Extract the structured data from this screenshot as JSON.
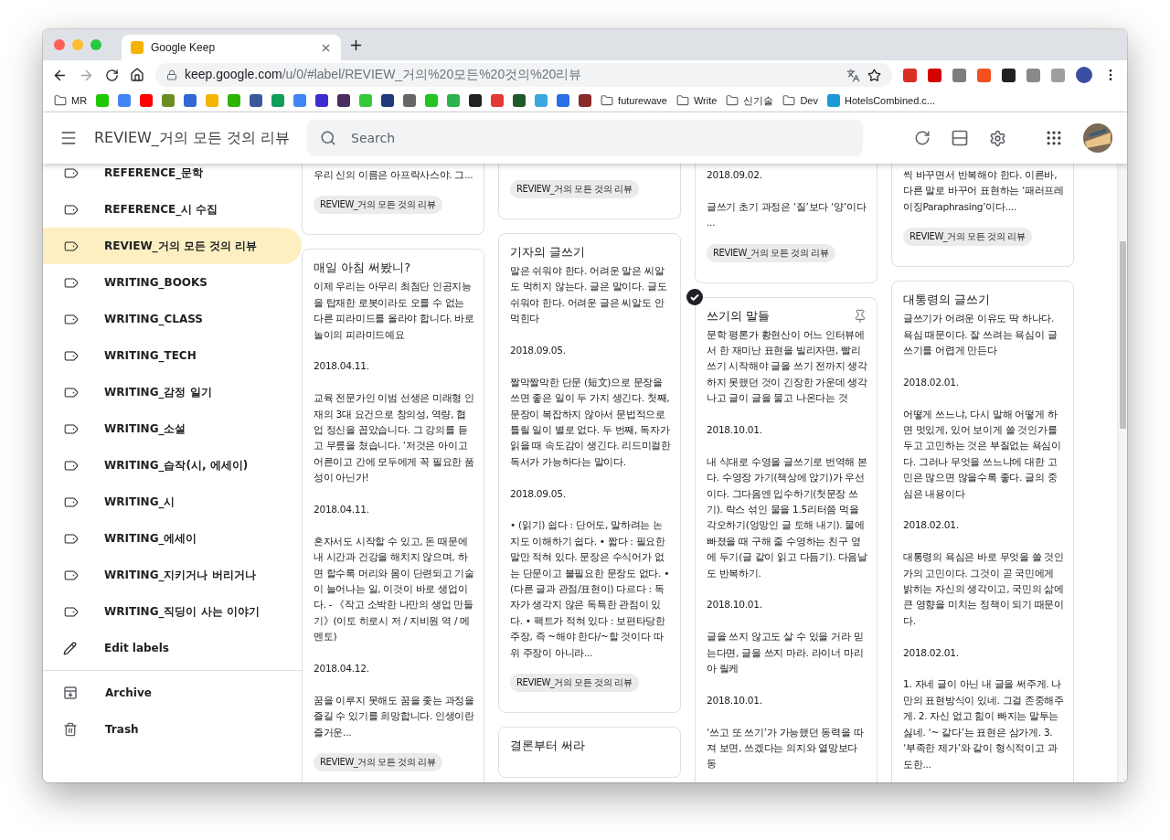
{
  "browser": {
    "tab": {
      "title": "Google Keep"
    },
    "url": {
      "host": "keep.google.com",
      "path": "/u/0/#label/REVIEW_거의%20모든%20것의%20리뷰"
    },
    "bookmarks": [
      {
        "kind": "folder",
        "label": "MR"
      },
      {
        "kind": "site",
        "color": "#1ec800"
      },
      {
        "kind": "site",
        "color": "#4285f4"
      },
      {
        "kind": "site",
        "color": "#ff0000"
      },
      {
        "kind": "site",
        "color": "#6b8e23"
      },
      {
        "kind": "site",
        "color": "#3367d6"
      },
      {
        "kind": "site",
        "color": "#f4b400"
      },
      {
        "kind": "site",
        "color": "#2db400"
      },
      {
        "kind": "site",
        "color": "#3b5998"
      },
      {
        "kind": "site",
        "color": "#0f9d58"
      },
      {
        "kind": "site",
        "color": "#4285f4"
      },
      {
        "kind": "site",
        "color": "#3f2bd0"
      },
      {
        "kind": "site",
        "color": "#4a2c5e"
      },
      {
        "kind": "site",
        "color": "#37c837"
      },
      {
        "kind": "site",
        "color": "#1f3a7a"
      },
      {
        "kind": "site",
        "color": "#666666"
      },
      {
        "kind": "site",
        "color": "#22c522"
      },
      {
        "kind": "site",
        "color": "#2bb24c"
      },
      {
        "kind": "site",
        "color": "#222222"
      },
      {
        "kind": "site",
        "color": "#e53935"
      },
      {
        "kind": "site",
        "color": "#1e5b2b"
      },
      {
        "kind": "site",
        "color": "#39a8e0"
      },
      {
        "kind": "site",
        "color": "#2a6ee8"
      },
      {
        "kind": "site",
        "color": "#8a2a2a"
      },
      {
        "kind": "folder",
        "label": "futurewave"
      },
      {
        "kind": "folder",
        "label": "Write"
      },
      {
        "kind": "folder",
        "label": "신기술"
      },
      {
        "kind": "folder",
        "label": "Dev"
      },
      {
        "kind": "site",
        "color": "#1a9bd7",
        "label": "HotelsCombined.c..."
      }
    ]
  },
  "app": {
    "title": "REVIEW_거의 모든 것의 리뷰",
    "search": {
      "placeholder": "Search"
    }
  },
  "sidebar": {
    "labels": [
      {
        "label": "REFERENCE_문학",
        "selected": false
      },
      {
        "label": "REFERENCE_시 수집",
        "selected": false
      },
      {
        "label": "REVIEW_거의 모든 것의 리뷰",
        "selected": true
      },
      {
        "label": "WRITING_BOOKS",
        "selected": false
      },
      {
        "label": "WRITING_CLASS",
        "selected": false
      },
      {
        "label": "WRITING_TECH",
        "selected": false
      },
      {
        "label": "WRITING_감정 일기",
        "selected": false
      },
      {
        "label": "WRITING_소설",
        "selected": false
      },
      {
        "label": "WRITING_습작(시, 에세이)",
        "selected": false
      },
      {
        "label": "WRITING_시",
        "selected": false
      },
      {
        "label": "WRITING_에세이",
        "selected": false
      },
      {
        "label": "WRITING_지키거나 버리거나",
        "selected": false
      },
      {
        "label": "WRITING_직딩이 사는 이야기",
        "selected": false
      }
    ],
    "edit_labels": "Edit labels",
    "bottom": [
      {
        "kind": "archive",
        "label": "Archive"
      },
      {
        "kind": "trash",
        "label": "Trash"
      }
    ]
  },
  "columns": [
    [
      {
        "cut_top": true,
        "selected": false,
        "paragraphs": [
          "우리 신의 이름은 아프락사스야. 그..."
        ],
        "chip": "REVIEW_거의 모든 것의 리뷰"
      },
      {
        "cut_top": false,
        "selected": false,
        "title": "매일 아침 써봤니?",
        "paragraphs": [
          "이제 우리는 아무리 최첨단 인공지능을 탑재한 로봇이라도 오를 수 없는 다른 피라미드를 올라야 합니다. 바로 놀이의 피라미드예요",
          "2018.04.11.",
          "교육 전문가인 이범 선생은 미래형 인재의 3대 요건으로 창의성, 역량, 협업 정신을 꼽았습니다. 그 강의를 듣고 무릎을 쳤습니다. ‘저것은 아이고 어른이고 간에 모두에게 꼭 필요한 품성이 아닌가!",
          "2018.04.11.",
          "혼자서도 시작할 수 있고, 돈 때문에 내 시간과 건강을 해치지 않으며, 하면 할수록 머리와 몸이 단련되고 기술이 늘어나는 일, 이것이 바로 생업이다. - 《작고 소박한 나만의 생업 만들기》(이토 히로시 저 / 지비원 역 / 메멘토)",
          "2018.04.12.",
          "꿈을 이루지 못해도 꿈을 좇는 과정을 즐길 수 있기를 희망합니다. 인생이란 즐거운..."
        ],
        "chip": "REVIEW_거의 모든 것의 리뷰"
      }
    ],
    [
      {
        "cut_top": true,
        "selected": false,
        "chip": "REVIEW_거의 모든 것의 리뷰"
      },
      {
        "cut_top": false,
        "selected": false,
        "title": "기자의 글쓰기",
        "paragraphs": [
          "말은 쉬워야 한다. 어려운 말은 씨알도 먹히지 않는다. 글은 말이다. 글도 쉬워야 한다. 어려운 글은 씨알도 안 먹힌다",
          "2018.09.05.",
          "짤막짤막한 단문 (短文)으로 문장을 쓰면 좋은 일이 두 가지 생긴다. 첫째, 문장이 복잡하지 않아서 문법적으로 틀릴 일이 별로 없다. 두 번째, 독자가 읽을 때 속도감이 생긴다. 리드미컬한 독서가 가능하다는 말이다.",
          "2018.09.05.",
          "• (읽기) 쉽다 : 단어도, 말하려는 논지도 이해하기 쉽다. • 짧다 : 필요한 말만 적혀 있다. 문장은 수식어가 없는 단문이고 불필요한 문장도 없다. • (다른 글과 관점/표현이) 다르다 : 독자가 생각지 않은 독특한 관점이 있다. • 팩트가 적혀 있다 : 보편타당한 주장, 즉 ~해야 한다/~할 것이다 따위 주장이 아니라..."
        ],
        "chip": "REVIEW_거의 모든 것의 리뷰"
      },
      {
        "cut_top": false,
        "selected": false,
        "title": "결론부터 써라"
      }
    ],
    [
      {
        "cut_top": true,
        "selected": false,
        "paragraphs": [
          "2018.09.02.",
          "글쓰기 초기 과정은 ‘질’보다 ‘양’이다 ..."
        ],
        "chip": "REVIEW_거의 모든 것의 리뷰"
      },
      {
        "cut_top": false,
        "selected": true,
        "title": "쓰기의 말들",
        "paragraphs": [
          "문학 평론가 황현산이 어느 인터뷰에서 한 재미난 표현을 빌리자면, 빨리 쓰기 시작해야 글을 쓰기 전까지 생각하지 못했던 것이 긴장한 가운데 생각나고 글이 글을 물고 나온다는 것",
          "2018.10.01.",
          "내 식대로 수영을 글쓰기로 번역해 본다. 수영장 가기(책상에 앉기)가 우선이다. 그다음엔 입수하기(첫문장 쓰기). 락스 섞인 물을 1.5리터쯤 먹을 각오하기(엉망인 글 토해 내기). 물에 빠졌을 때 구해 줄 수영하는 친구 옆에 두기(글 같이 읽고 다듬기). 다음날도 반복하기.",
          "2018.10.01.",
          "글을 쓰지 않고도 살 수 있을 거라 믿는다면, 글을 쓰지 마라. 라이너 마리아 릴케",
          "2018.10.01.",
          "‘쓰고 또 쓰기’가 가능했던 동력을 따져 보면, 쓰겠다는 의지와 열망보다 동"
        ]
      }
    ],
    [
      {
        "cut_top": true,
        "selected": false,
        "paragraphs": [
          "씩 바꾸면서 반복해야 한다. 이른바, 다른 말로 바꾸어 표현하는 ‘패러프레이징Paraphrasing’이다...."
        ],
        "chip": "REVIEW_거의 모든 것의 리뷰"
      },
      {
        "cut_top": false,
        "selected": false,
        "title": "대통령의 글쓰기",
        "paragraphs": [
          "글쓰기가 어려운 이유도 딱 하나다. 욕심 때문이다. 잘 쓰려는 욕심이 글쓰기를 어렵게 만든다",
          "2018.02.01.",
          "어떻게 쓰느냐, 다시 말해 어떻게 하면 멋있게, 있어 보이게 쓸 것인가를 두고 고민하는 것은 부질없는 욕심이다. 그러나 무엇을 쓰느냐에 대한 고민은 많으면 많을수록 좋다. 글의 중심은 내용이다",
          "2018.02.01.",
          "대통령의 욕심은 바로 무엇을 쓸 것인가의 고민이다. 그것이 곧 국민에게 밝히는 자신의 생각이고, 국민의 삶에 큰 영향을 미치는 정책이 되기 때문이다.",
          "2018.02.01.",
          "1. 자네 글이 아닌 내 글을 써주게. 나만의 표현방식이 있네. 그걸 존중해주게. 2. 자신 없고 힘이 빠지는 말투는 싫네. ‘~ 같다’는 표현은 삼가게. 3. ‘부족한 제가’와 같이 형식적이고 과도한..."
        ]
      }
    ]
  ]
}
